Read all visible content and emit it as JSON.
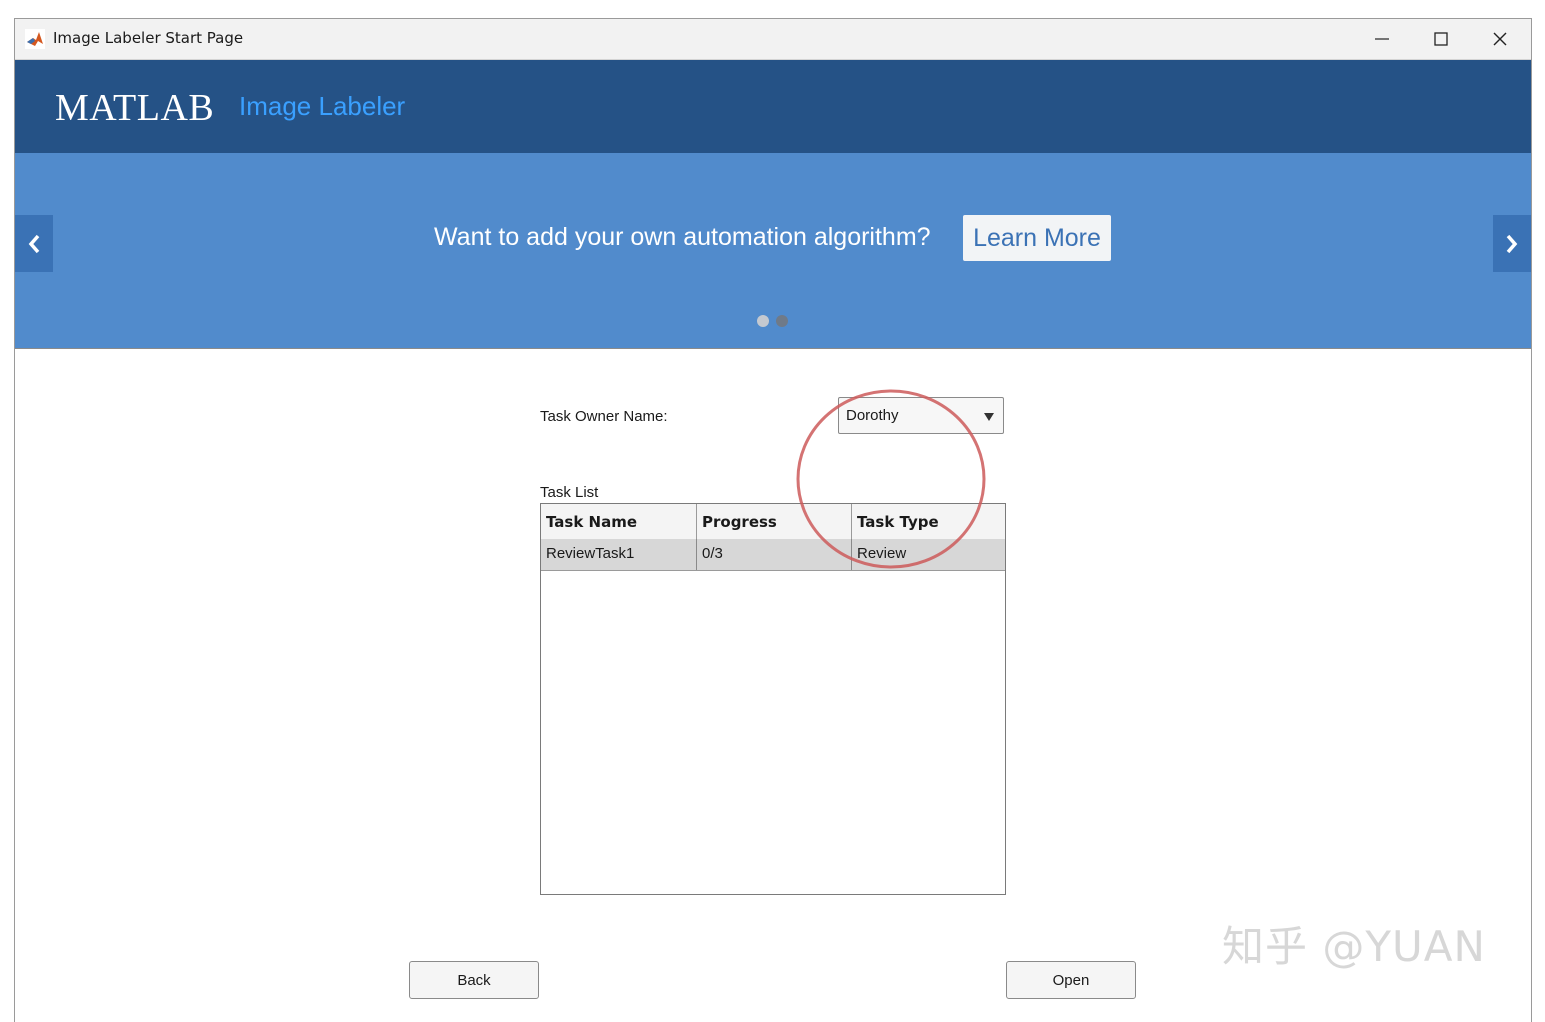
{
  "window": {
    "title": "Image Labeler Start Page",
    "icon": "matlab-logo-icon",
    "controls": [
      "minimize-icon",
      "maximize-icon",
      "close-icon"
    ]
  },
  "header": {
    "brand": "MATLAB",
    "product": "Image Labeler",
    "colors": {
      "background": "#255286",
      "product_text": "#3aa0ff"
    }
  },
  "banner": {
    "message": "Want to add your own automation algorithm?",
    "link_label": "Learn More",
    "prev_icon": "chevron-left-icon",
    "next_icon": "chevron-right-icon",
    "slide_count": 2,
    "colors": {
      "background": "#518bcc"
    }
  },
  "task_owner": {
    "label": "Task Owner Name:",
    "selected": "Dorothy"
  },
  "task_list": {
    "label": "Task List",
    "columns": [
      "Task Name",
      "Progress",
      "Task Type"
    ],
    "rows": [
      {
        "name": "ReviewTask1",
        "progress": "0/3",
        "type": "Review"
      }
    ]
  },
  "buttons": {
    "back": "Back",
    "open": "Open"
  },
  "annotation": {
    "color": "#cc5b5b"
  },
  "watermark": "知乎 @YUAN"
}
